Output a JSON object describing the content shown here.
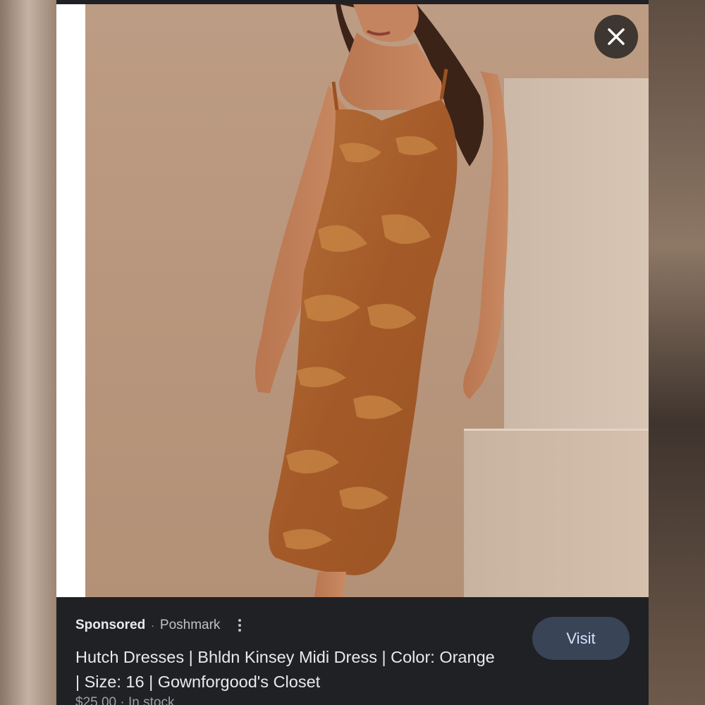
{
  "close": {
    "label": "Close"
  },
  "ad": {
    "sponsored_label": "Sponsored",
    "separator": "·",
    "merchant": "Poshmark",
    "title": "Hutch Dresses | Bhldn Kinsey Midi Dress | Color: Orange | Size: 16 | Gownforgood's Closet",
    "price_partial": "$25.00 · In stock",
    "visit_label": "Visit"
  },
  "colors": {
    "panel_bg": "#202124",
    "visit_button_bg": "#394457",
    "visit_button_text": "#d2e3fc",
    "dress": "#a8612e",
    "wall": "#b8967d"
  },
  "icons": {
    "close": "close-icon",
    "more": "more-vert-icon"
  }
}
